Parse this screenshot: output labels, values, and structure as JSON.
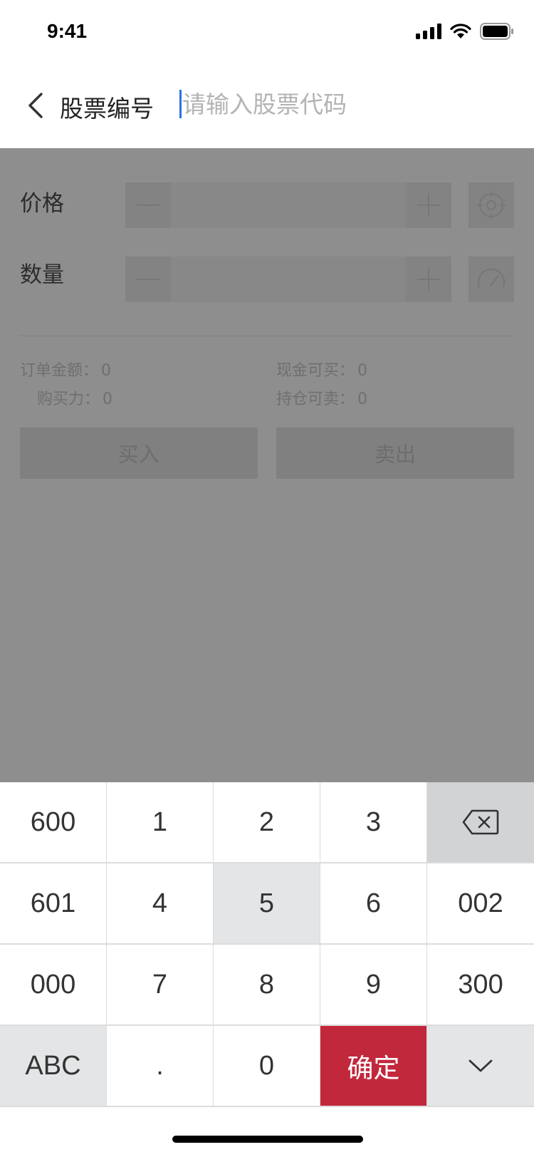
{
  "status_bar": {
    "time": "9:41"
  },
  "header": {
    "label": "股票编号",
    "search_placeholder": "请输入股票代码",
    "search_value": ""
  },
  "form": {
    "price_label": "价格",
    "quantity_label": "数量",
    "order_amount_label": "订单金额：",
    "order_amount_value": "0",
    "buying_power_label": "购买力：",
    "buying_power_value": "0",
    "cash_buyable_label": "现金可买：",
    "cash_buyable_value": "0",
    "position_sellable_label": "持仓可卖：",
    "position_sellable_value": "0",
    "buy_label": "买入",
    "sell_label": "卖出"
  },
  "keyboard": {
    "keys": [
      [
        "600",
        "1",
        "2",
        "3",
        "backspace-icon"
      ],
      [
        "601",
        "4",
        "5",
        "6",
        "002"
      ],
      [
        "000",
        "7",
        "8",
        "9",
        "300"
      ],
      [
        "ABC",
        ".",
        "0",
        "确定",
        "chevron-down-icon"
      ]
    ],
    "confirm_color": "#c2283c"
  }
}
